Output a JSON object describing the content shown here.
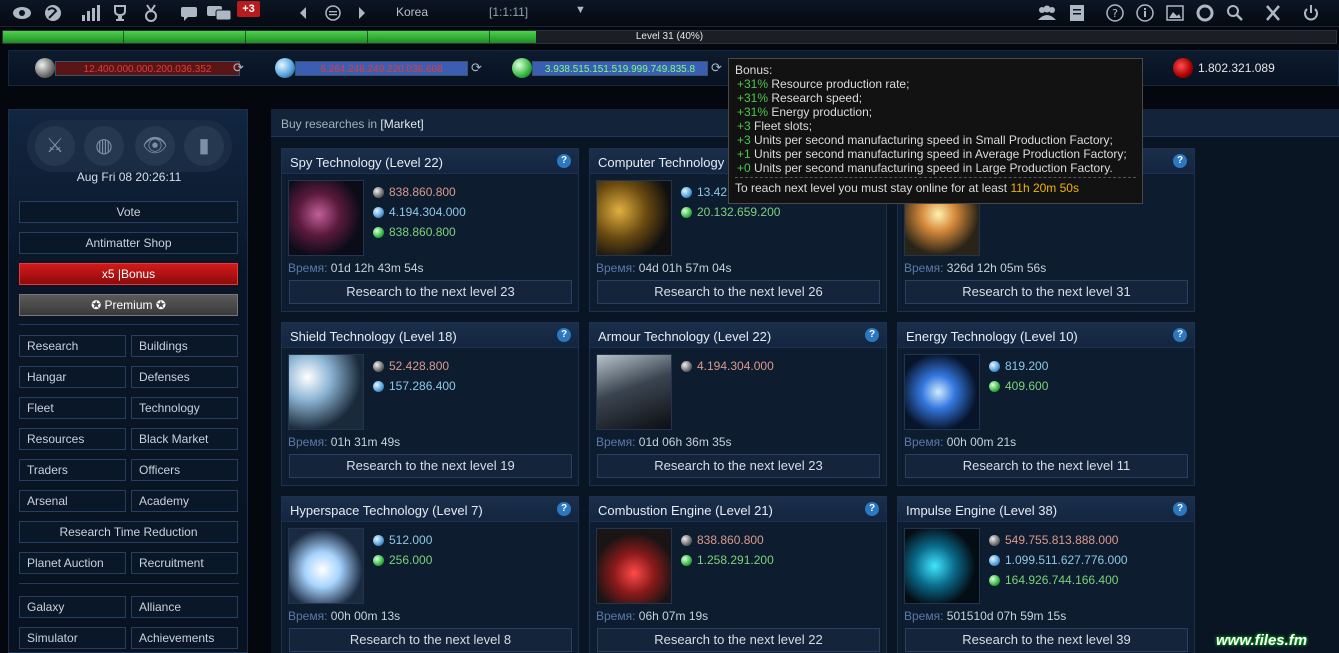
{
  "topbar": {
    "notification_count": "+3",
    "planet_name": "Korea",
    "planet_coords": "[1:1:11]"
  },
  "level": {
    "label": "Level 31 (40%)",
    "progress_fraction": 0.4
  },
  "resources": {
    "metal": "12.400.000.000.200.036.352",
    "crystal": "6.264.248.249.220.036.608",
    "deuterium": "3.938.515.151.519.999.749.835.8",
    "dark_matter": "1.802.321.089"
  },
  "tooltip": {
    "title": "Bonus:",
    "lines": [
      {
        "value": "+31%",
        "text": " Resource production rate;"
      },
      {
        "value": "+31%",
        "text": " Research speed;"
      },
      {
        "value": "+31%",
        "text": " Energy production;"
      },
      {
        "value": "+3",
        "text": " Fleet slots;"
      },
      {
        "value": "+3",
        "text": " Units per second manufacturing speed in Small Production Factory;"
      },
      {
        "value": "+1",
        "text": " Units per second manufacturing speed in Average Production Factory;"
      },
      {
        "value": "+0",
        "text": " Units per second manufacturing speed in Large Production Factory."
      }
    ],
    "footer": "To reach next level you must stay online for at least ",
    "footer_time": "11h 20m 50s"
  },
  "sidebar": {
    "date": "Aug Fri 08 20:26:11",
    "vote": "Vote",
    "antimatter_shop": "Antimatter Shop",
    "bonus": "x5 |Bonus",
    "premium": "Premium",
    "nav": [
      [
        "Research",
        "Buildings"
      ],
      [
        "Hangar",
        "Defenses"
      ],
      [
        "Fleet",
        "Technology"
      ],
      [
        "Resources",
        "Black Market"
      ],
      [
        "Traders",
        "Officers"
      ],
      [
        "Arsenal",
        "Academy"
      ]
    ],
    "research_time_reduction": "Research Time Reduction",
    "nav2": [
      "Planet Auction",
      "Recruitment"
    ],
    "nav3": [
      [
        "Galaxy",
        "Alliance"
      ],
      [
        "Simulator",
        "Achievements"
      ]
    ]
  },
  "main": {
    "header_prefix": "Buy researches in ",
    "header_market": "[Market]",
    "time_label": "Время:",
    "cards": [
      {
        "title": "Spy Technology (Level 22)",
        "metal": "838.860.800",
        "crystal": "4.194.304.000",
        "deut": "838.860.800",
        "time": "01d 12h 43m 54s",
        "button": "Research to the next level 23"
      },
      {
        "title": "Computer Technology",
        "crystal": "13.42",
        "deut": "20.132.659.200",
        "time": "04d 01h 57m 04s",
        "button": "Research to the next level 26"
      },
      {
        "title": "",
        "crystal": "214.748.364.800",
        "time": "326d 12h 05m 56s",
        "button": "Research to the next level 31"
      },
      {
        "title": "Shield Technology (Level 18)",
        "metal": "52.428.800",
        "crystal": "157.286.400",
        "time": "01h 31m 49s",
        "button": "Research to the next level 19"
      },
      {
        "title": "Armour Technology (Level 22)",
        "metal": "4.194.304.000",
        "time": "01d 06h 36m 35s",
        "button": "Research to the next level 23"
      },
      {
        "title": "Energy Technology (Level 10)",
        "crystal": "819.200",
        "deut": "409.600",
        "time": "00h 00m 21s",
        "button": "Research to the next level 11"
      },
      {
        "title": "Hyperspace Technology (Level 7)",
        "crystal": "512.000",
        "deut": "256.000",
        "time": "00h 00m 13s",
        "button": "Research to the next level 8"
      },
      {
        "title": "Combustion Engine (Level 21)",
        "metal": "838.860.800",
        "deut": "1.258.291.200",
        "time": "06h 07m 19s",
        "button": "Research to the next level 22"
      },
      {
        "title": "Impulse Engine (Level 38)",
        "metal": "549.755.813.888.000",
        "crystal": "1.099.511.627.776.000",
        "deut": "164.926.744.166.400",
        "time": "501510d 07h 59m 15s",
        "button": "Research to the next level 39"
      }
    ]
  },
  "watermark": "www.files.fm",
  "colors": {
    "accent_green": "#2fb838",
    "bonus_red": "#c21414",
    "panel_blue": "#0e1c2f",
    "help_blue": "#2b78c0"
  }
}
